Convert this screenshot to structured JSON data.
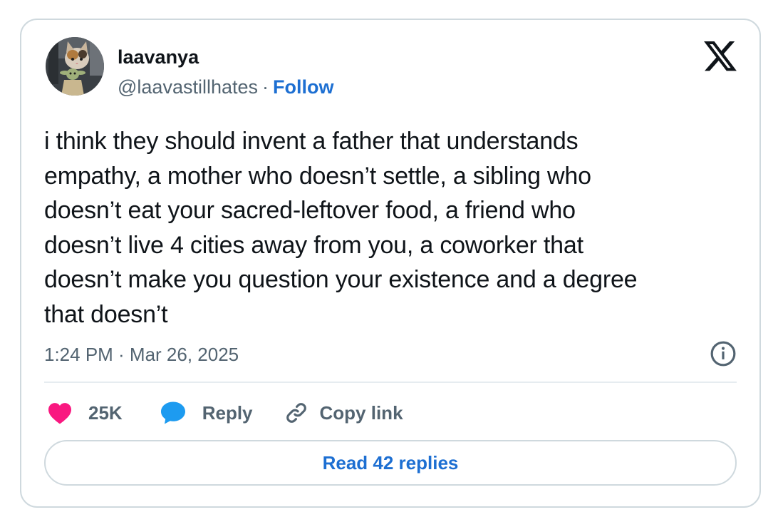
{
  "author": {
    "name": "laavanya",
    "handle": "@laavastillhates",
    "separator": "·",
    "follow_label": "Follow",
    "avatar_icon": "avatar-photo"
  },
  "platform": {
    "logo_icon": "x-logo-icon"
  },
  "tweet": {
    "text": "i think they should invent a father that understands\nempathy, a mother who doesn’t settle, a sibling who\ndoesn’t eat your sacred-leftover food, a friend who\ndoesn’t live 4 cities away from you, a coworker that\ndoesn’t make you question your existence and a degree\nthat doesn’t",
    "timestamp": "1:24 PM · Mar 26, 2025"
  },
  "actions": {
    "like_count": "25K",
    "reply_label": "Reply",
    "copy_label": "Copy link"
  },
  "replies_button": {
    "label": "Read 42 replies"
  },
  "colors": {
    "text": "#0f1419",
    "secondary": "#536471",
    "link": "#1d6fd2",
    "heart": "#f91880",
    "reply_bubble": "#1d9bf0",
    "border": "#cfd9de"
  }
}
